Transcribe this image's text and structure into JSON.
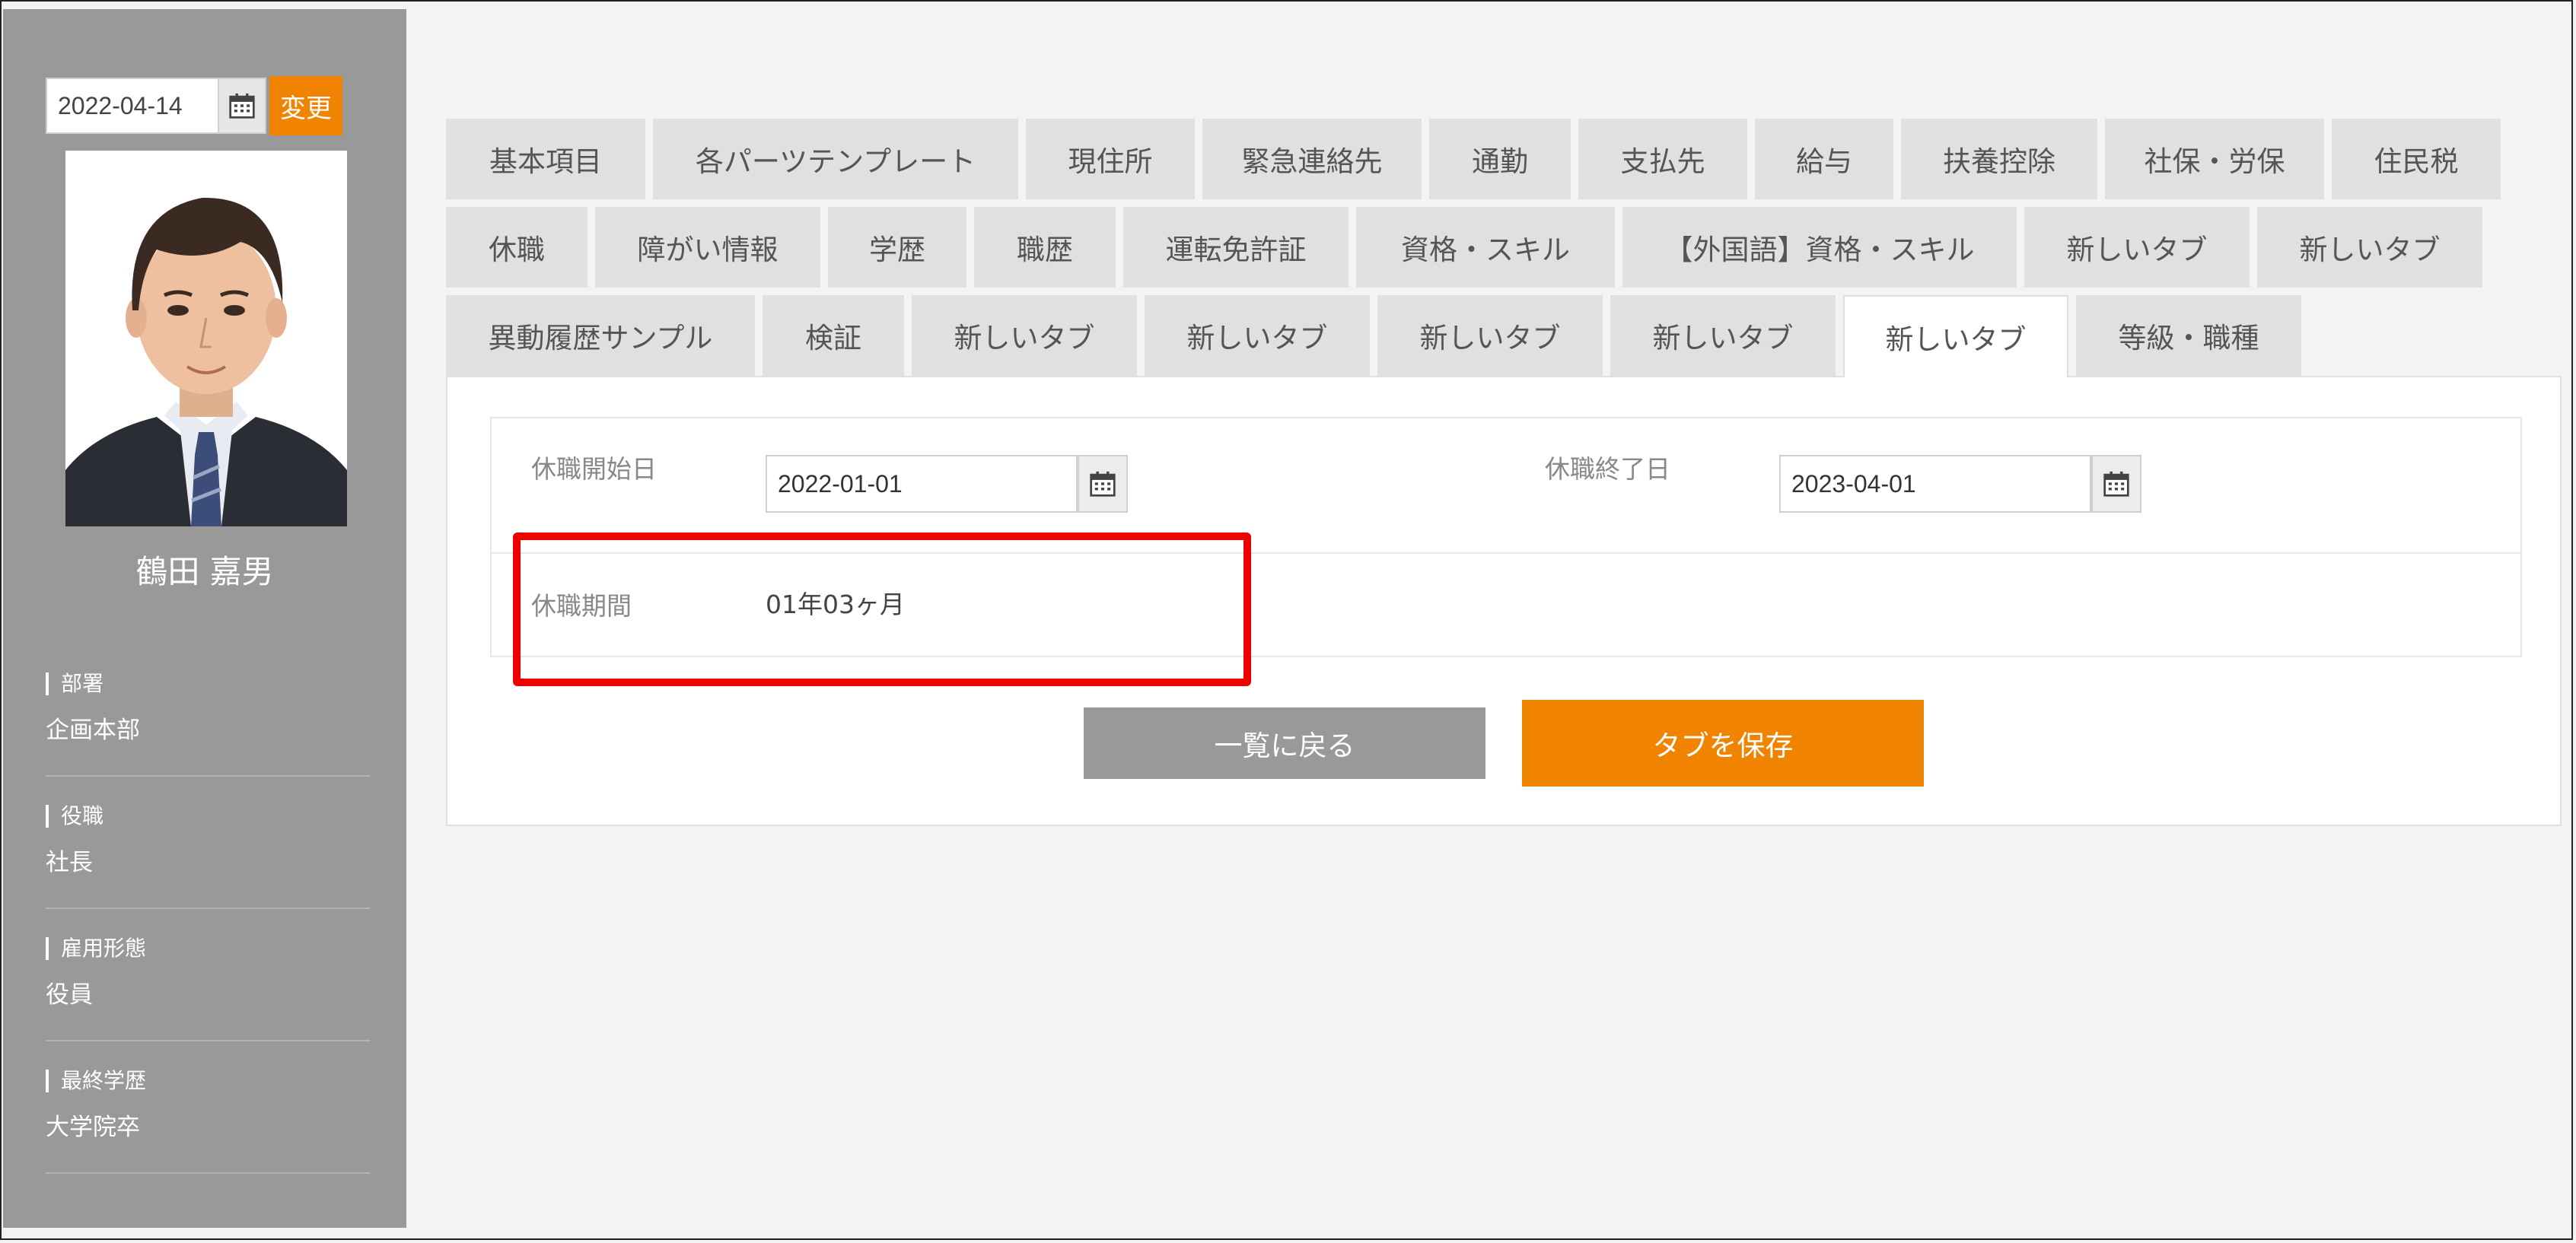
{
  "sidebar": {
    "date_value": "2022-04-14",
    "calendar_icon": "calendar-icon",
    "change_label": "変更",
    "employee_name": "鶴田 嘉男",
    "info": [
      {
        "label": "部署",
        "value": "企画本部"
      },
      {
        "label": "役職",
        "value": "社長"
      },
      {
        "label": "雇用形態",
        "value": "役員"
      },
      {
        "label": "最終学歴",
        "value": "大学院卒"
      }
    ]
  },
  "tabs": {
    "row1": [
      "基本項目",
      "各パーツテンプレート",
      "現住所",
      "緊急連絡先",
      "通勤",
      "支払先",
      "給与",
      "扶養控除",
      "社保・労保",
      "住民税"
    ],
    "row2": [
      "休職",
      "障がい情報",
      "学歴",
      "職歴",
      "運転免許証",
      "資格・スキル",
      "【外国語】資格・スキル",
      "新しいタブ",
      "新しいタブ"
    ],
    "row3": [
      "異動履歴サンプル",
      "検証",
      "新しいタブ",
      "新しいタブ",
      "新しいタブ",
      "新しいタブ",
      "新しいタブ",
      "等級・職種"
    ],
    "active_tab": "新しいタブ"
  },
  "form": {
    "start_label": "休職開始日",
    "start_value": "2022-01-01",
    "end_label": "休職終了日",
    "end_value": "2023-04-01",
    "period_label": "休職期間",
    "period_value": "01年03ヶ月"
  },
  "buttons": {
    "back_label": "一覧に戻る",
    "save_label": "タブを保存"
  },
  "colors": {
    "accent": "#f08300",
    "sidebar": "#999999",
    "highlight": "#ee0000"
  }
}
